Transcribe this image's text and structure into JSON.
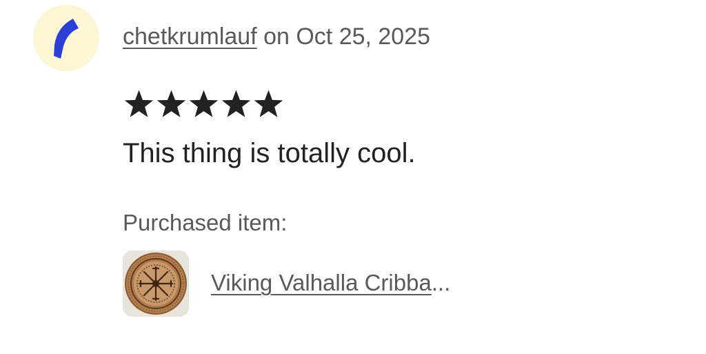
{
  "review": {
    "username": "chetkrumlauf",
    "date_text": " on Oct 25, 2025",
    "rating": 5,
    "rating_max": 5,
    "text": "This thing is totally cool.",
    "purchased_label": "Purchased item:",
    "item_title": "Viking Valhalla Cribba",
    "item_ellipsis": "..."
  },
  "colors": {
    "avatar_bg": "#fdf6d4",
    "avatar_mark": "#2b3fd6",
    "star": "#222222",
    "muted_text": "#595959",
    "body_text": "#222222"
  },
  "icons": {
    "avatar": "blue-arc-avatar-icon",
    "star": "star-icon",
    "thumbnail": "viking-cribbage-board-thumbnail"
  }
}
